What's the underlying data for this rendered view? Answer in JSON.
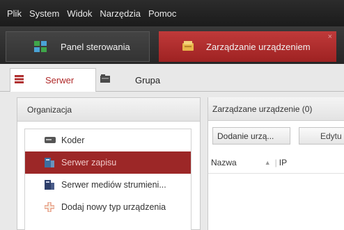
{
  "menu": {
    "items": [
      "Plik",
      "System",
      "Widok",
      "Narzędzia",
      "Pomoc"
    ]
  },
  "module_tabs": {
    "control_panel": {
      "label": "Panel sterowania",
      "icon": "grid-icon"
    },
    "device_management": {
      "label": "Zarządzanie urządzeniem",
      "icon": "device-box-icon",
      "close": "×"
    }
  },
  "sub_tabs": {
    "server": {
      "label": "Serwer",
      "icon": "server-icon"
    },
    "group": {
      "label": "Grupa",
      "icon": "group-folder-icon"
    }
  },
  "left_panel": {
    "title": "Organizacja",
    "items": [
      {
        "label": "Koder",
        "icon": "encoder-icon"
      },
      {
        "label": "Serwer zapisu",
        "icon": "storage-server-icon",
        "selected": true
      },
      {
        "label": "Serwer mediów strumieni...",
        "icon": "stream-server-icon"
      },
      {
        "label": "Dodaj nowy typ urządzenia",
        "icon": "add-device-type-icon"
      }
    ]
  },
  "right_panel": {
    "title": "Zarządzane urządzenie (0)",
    "buttons": {
      "add": "Dodanie urzą...",
      "edit": "Edytu"
    },
    "columns": {
      "name": "Nazwa",
      "sort": "▲",
      "separator": "|",
      "ip": "IP"
    }
  },
  "colors": {
    "menubar": "#1e1e1e",
    "accent_red": "#a82a2a",
    "selected_row": "#9c2727"
  }
}
